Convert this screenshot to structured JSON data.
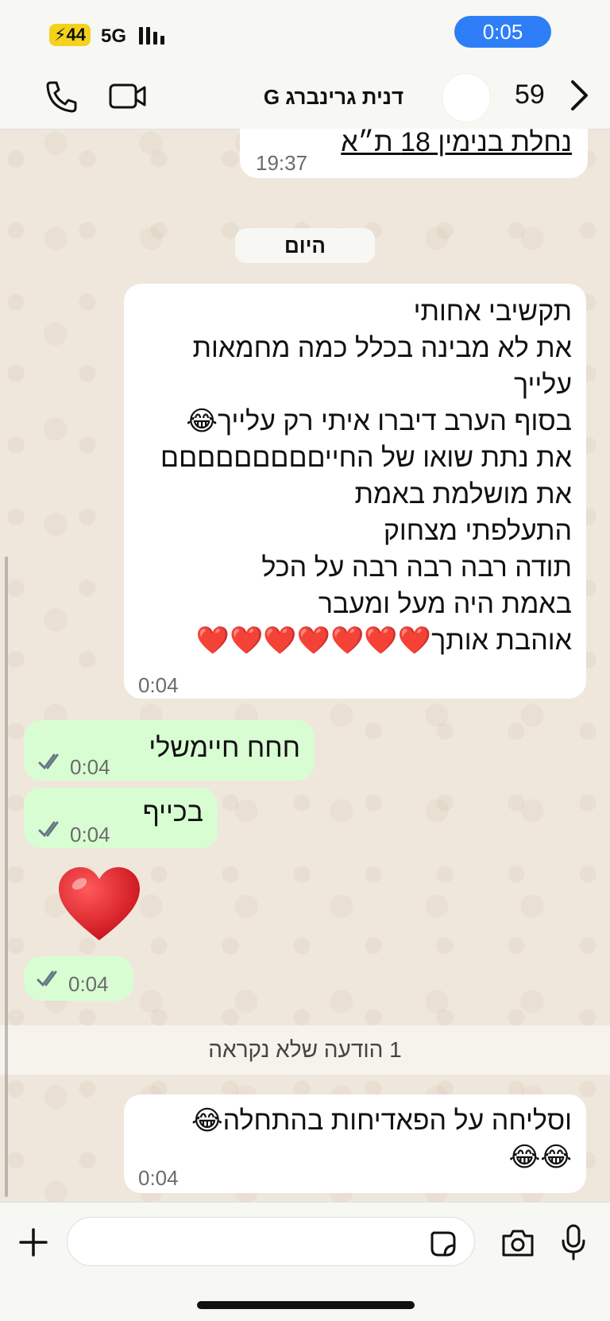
{
  "status_bar": {
    "battery": "44",
    "network": "5G",
    "time": "0:05"
  },
  "header": {
    "contact_name": "דנית גרינברג G",
    "unread_count": "59",
    "icons": [
      "phone-icon",
      "video-icon",
      "chevron-right-icon"
    ]
  },
  "messages": {
    "partial_top": {
      "text": "נחלת בנימין 18 ת״א",
      "time": "19:37"
    },
    "day_separator": "היום",
    "long_incoming": {
      "lines": [
        "תקשיבי אחותי",
        "את לא מבינה בכלל כמה מחמאות",
        "עלייך",
        "בסוף הערב דיברו איתי רק עלייך😂",
        "את נתת שואו של החייםםםםםםםםם",
        "את מושלמת באמת",
        "התעלפתי מצחוק",
        "תודה רבה רבה רבה על הכל",
        "באמת היה מעל ומעבר",
        "אוהבת אותך❤️❤️❤️❤️❤️❤️❤️"
      ],
      "time": "0:04"
    },
    "out_1": {
      "text": "חחח חיימשלי",
      "time": "0:04"
    },
    "out_2": {
      "text": "בכייף",
      "time": "0:04"
    },
    "out_heart": {
      "emoji": "❤️",
      "time": "0:04"
    },
    "unread_banner": "1 הודעה שלא נקראה",
    "last_incoming": {
      "lines": [
        "וסליחה על הפאדיחות בהתחלה😂",
        "😂😂"
      ],
      "time": "0:04"
    }
  },
  "composer": {
    "icons": [
      "plus-icon",
      "sticker-icon",
      "camera-icon",
      "microphone-icon"
    ]
  },
  "colors": {
    "outgoing_bubble": "#d9fdd3",
    "incoming_bubble": "#ffffff",
    "time_pill": "#2d7ef7",
    "battery": "#f4d21c"
  }
}
